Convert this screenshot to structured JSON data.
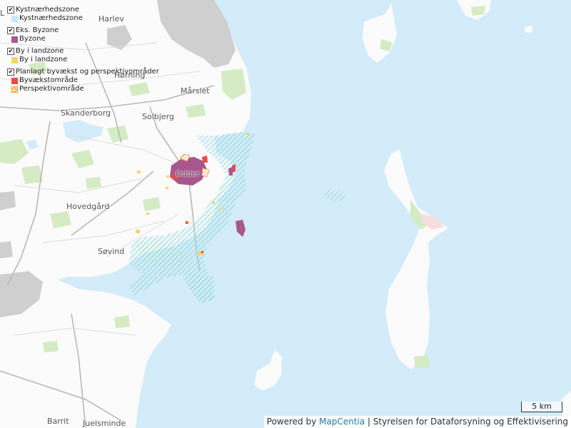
{
  "legend": {
    "groups": [
      {
        "title": "Kystnærhedszone",
        "items": [
          {
            "label": "Kystnærhedszone",
            "color": "#c7e9f5"
          }
        ]
      },
      {
        "title": "Eks. Byzone",
        "items": [
          {
            "label": "Byzone",
            "color": "#a8578d"
          }
        ]
      },
      {
        "title": "By i landzone",
        "items": [
          {
            "label": "By i landzone",
            "color": "#f5d56b"
          }
        ]
      },
      {
        "title": "Planlagt byvækst og perspektivområder",
        "items": [
          {
            "label": "Byvækstområde",
            "color": "#ef4a4a"
          },
          {
            "label": "Perspektivområde",
            "color": "#f39a3c"
          }
        ]
      }
    ]
  },
  "places": {
    "harlev": "Harlev",
    "horning": "Hørning",
    "marslet": "Mårslet",
    "skanderborg": "Skanderborg",
    "solbjerg": "Solbjerg",
    "odder": "Odder",
    "hovedgard": "Hovedgård",
    "sovind": "Søvind",
    "barrit": "Barrit",
    "juelsminde": "Juelsminde",
    "left_edge": "L"
  },
  "scale": {
    "label": "5 km"
  },
  "attribution": {
    "prefix": "Powered by ",
    "link": "MapCentia",
    "suffix": " | Styrelsen for Dataforsyning og Effektivisering"
  },
  "colors": {
    "sea": "#d3ecf9",
    "land": "#fbfbfb",
    "forest": "#d5ebc4",
    "urban": "#c9c9c9",
    "coastal_zone": "#8fd3e3",
    "byzone": "#a8578d",
    "by_i_landzone": "#f5d56b",
    "byvaekst": "#ef4a4a",
    "perspektiv": "#f39a3c"
  }
}
